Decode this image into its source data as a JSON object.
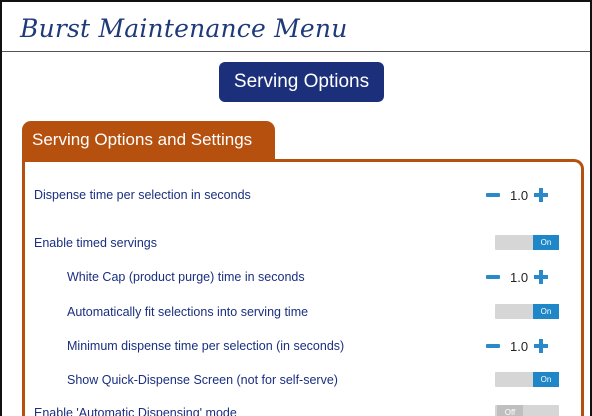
{
  "header": {
    "title": "Burst Maintenance Menu"
  },
  "section_button": {
    "label": "Serving Options"
  },
  "panel": {
    "title": "Serving Options and Settings"
  },
  "settings": [
    {
      "label": "Dispense time per selection in seconds",
      "control": "stepper",
      "value": "1.0"
    },
    {
      "label": "Enable timed servings",
      "control": "toggle",
      "state": "On"
    },
    {
      "label": "White Cap (product purge) time in seconds",
      "control": "stepper",
      "value": "1.0"
    },
    {
      "label": "Automatically fit selections into serving time",
      "control": "toggle",
      "state": "On"
    },
    {
      "label": "Minimum dispense time per selection (in seconds)",
      "control": "stepper",
      "value": "1.0"
    },
    {
      "label": "Show Quick-Dispense Screen (not for self-serve)",
      "control": "toggle",
      "state": "On"
    },
    {
      "label": "Enable 'Automatic Dispensing' mode",
      "control": "toggle",
      "state": "Off"
    }
  ],
  "icons": {
    "decrement": "minus-icon",
    "increment": "plus-icon"
  },
  "colors": {
    "accent": "#1c2f7a",
    "panel": "#b5500f",
    "control": "#2a8ac9",
    "text": "#1a2f80"
  }
}
